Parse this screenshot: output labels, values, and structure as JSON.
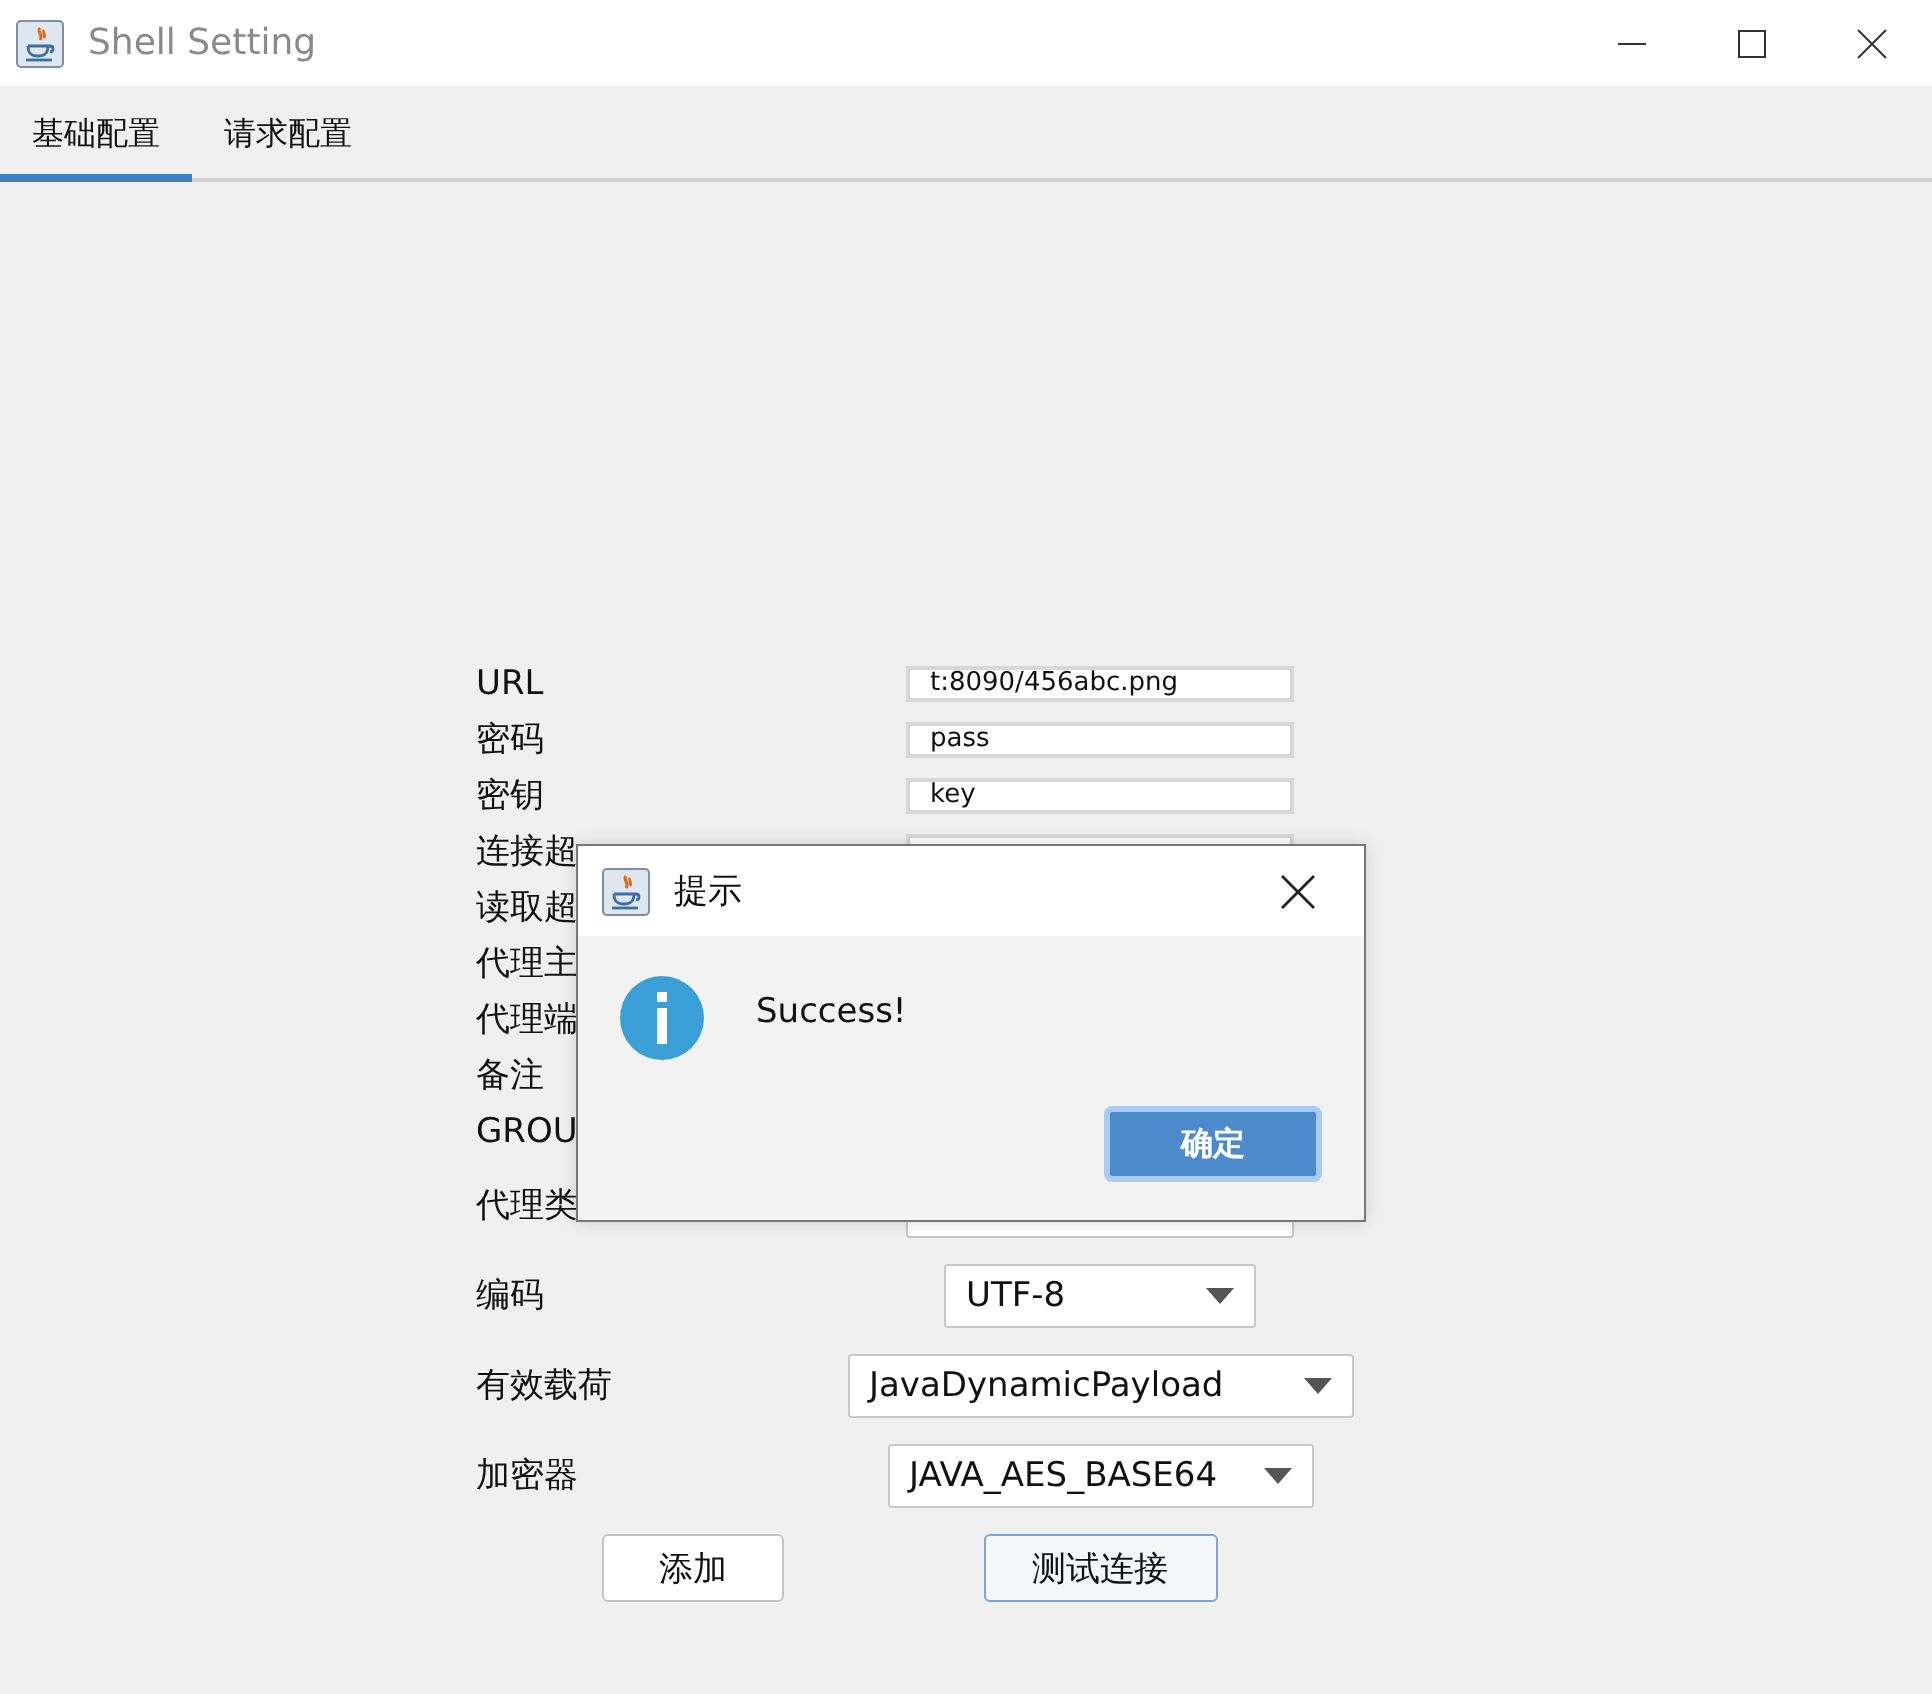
{
  "window": {
    "title": "Shell Setting"
  },
  "tabs": [
    {
      "label": "基础配置",
      "selected": true
    },
    {
      "label": "请求配置",
      "selected": false
    }
  ],
  "form": {
    "rows": [
      {
        "kind": "text",
        "label": "URL",
        "value": "t:8090/456abc.png"
      },
      {
        "kind": "text",
        "label": "密码",
        "value": "pass"
      },
      {
        "kind": "text",
        "label": "密钥",
        "value": "key"
      },
      {
        "kind": "text",
        "label": "连接超"
      },
      {
        "kind": "covered",
        "label": "读取超"
      },
      {
        "kind": "covered",
        "label": "代理主"
      },
      {
        "kind": "covered",
        "label": "代理端"
      },
      {
        "kind": "covered",
        "label": "备注"
      },
      {
        "kind": "covered",
        "label": "GROU"
      },
      {
        "kind": "combo",
        "label": "代理类"
      },
      {
        "kind": "combo",
        "label": "编码",
        "value": "UTF-8"
      },
      {
        "kind": "combo",
        "label": "有效载荷",
        "value": "JavaDynamicPayload"
      },
      {
        "kind": "combo",
        "label": "加密器",
        "value": "JAVA_AES_BASE64"
      }
    ],
    "buttons": [
      {
        "label": "添加",
        "focused": false
      },
      {
        "label": "测试连接",
        "focused": true
      }
    ]
  },
  "dialog": {
    "title": "提示",
    "message": "Success!",
    "button": "确定"
  }
}
